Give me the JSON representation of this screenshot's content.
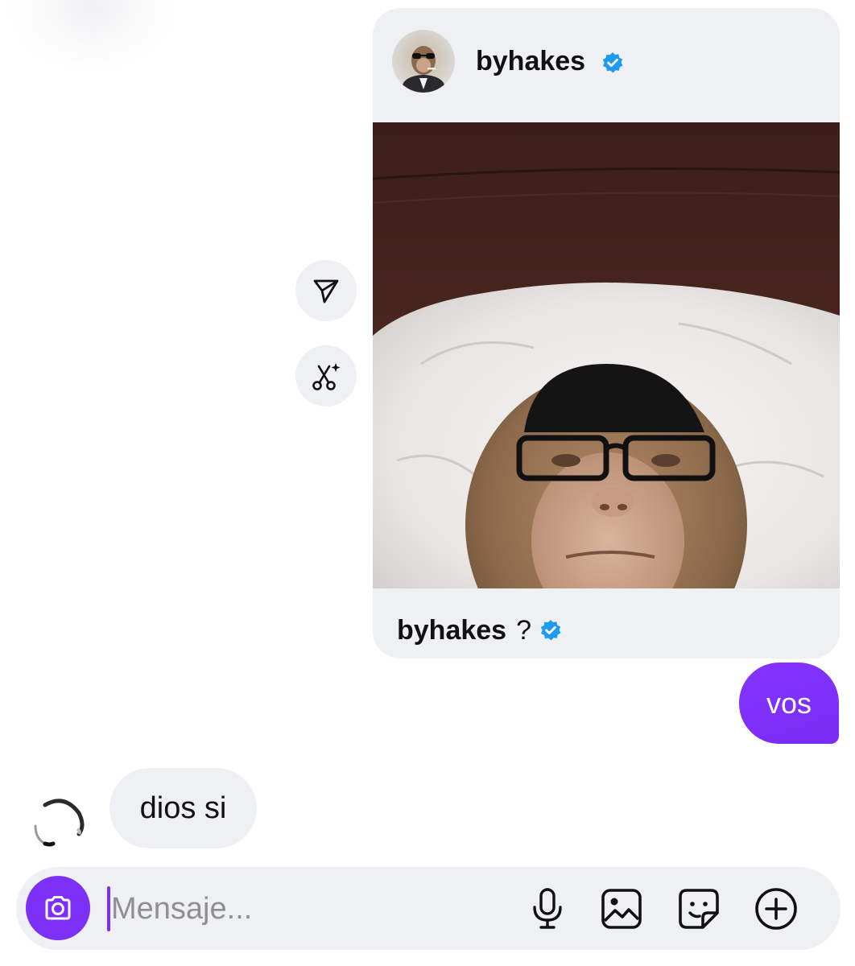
{
  "shared_post": {
    "username": "byhakes",
    "verified": true,
    "caption_user": "byhakes",
    "caption_text": "?"
  },
  "side_actions": [
    {
      "icon": "send-icon"
    },
    {
      "icon": "ai-scissors-icon"
    }
  ],
  "messages": {
    "outgoing": {
      "text": "vos"
    },
    "incoming": {
      "text": "dios si"
    }
  },
  "composer": {
    "placeholder": "Mensaje...",
    "value": "",
    "tools": [
      "microphone-icon",
      "gallery-icon",
      "sticker-icon",
      "plus-circle-icon"
    ]
  },
  "colors": {
    "accent": "#7b2ff7",
    "bubble_gray": "#eff0f4",
    "verified_blue": "#1d9bf0"
  }
}
